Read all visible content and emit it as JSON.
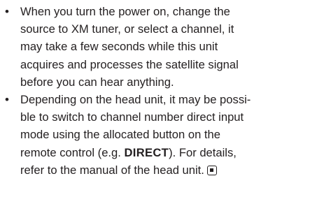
{
  "notes": [
    {
      "bullet": "•",
      "lines": [
        "When you turn the power on, change the",
        "source to XM tuner, or select a channel, it",
        "may take a few seconds while this unit",
        "acquires and processes the satellite signal",
        "before you can hear anything."
      ]
    },
    {
      "bullet": "•",
      "lines": [
        "Depending on the head unit, it may be possi-",
        "ble to switch to channel number direct input",
        "mode using the allocated button on the"
      ],
      "line4_before": "remote control (e.g. ",
      "line4_bold": "DIRECT",
      "line4_after": "). For details,",
      "line5": "refer to the manual of the head unit.",
      "end_icon": "end-of-section-icon"
    }
  ]
}
